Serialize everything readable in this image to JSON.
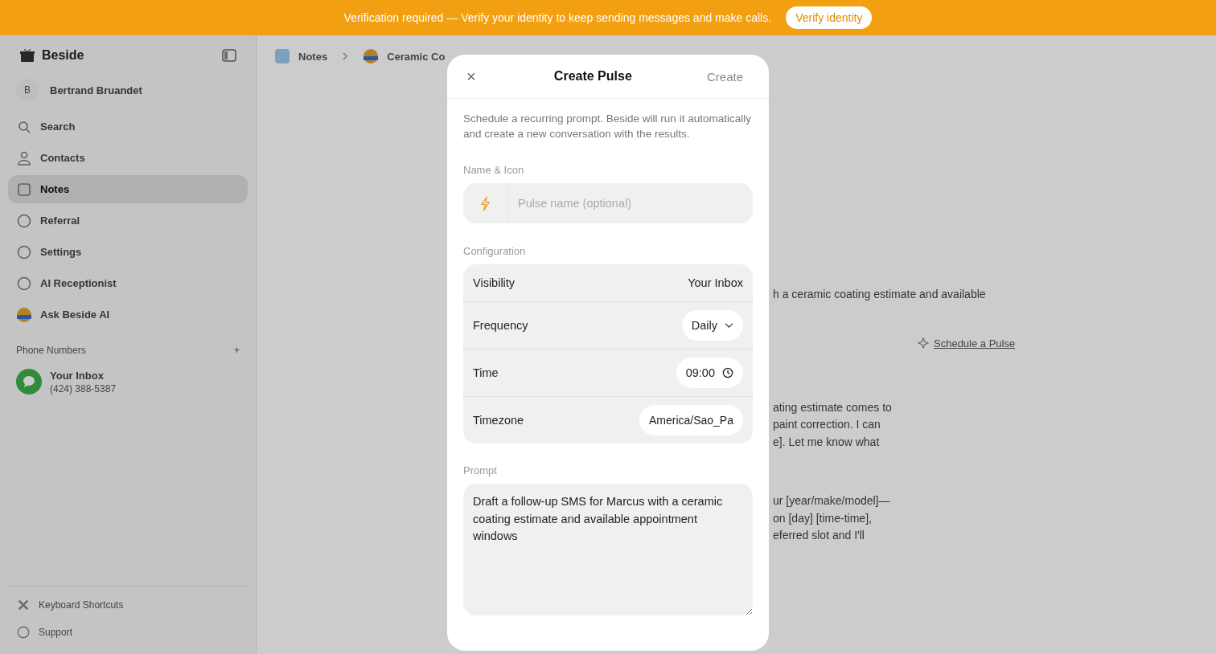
{
  "banner": {
    "message": "Verification required — Verify your identity to keep sending messages and make calls.",
    "button": "Verify identity"
  },
  "sidebar": {
    "brand": "Beside",
    "user": {
      "initial": "B",
      "name": "Bertrand Bruandet"
    },
    "items": [
      {
        "label": "Search",
        "selected": false
      },
      {
        "label": "Contacts",
        "selected": false
      },
      {
        "label": "Notes",
        "selected": true
      },
      {
        "label": "Referral",
        "selected": false
      },
      {
        "label": "Settings",
        "selected": false
      },
      {
        "label": "AI Receptionist",
        "selected": false
      },
      {
        "label": "Ask Beside AI",
        "selected": false
      }
    ],
    "section_title": "Phone Numbers",
    "section_action": "+",
    "inboxes": [
      {
        "name": "Your Inbox",
        "phone": "(424) 388-5387"
      }
    ],
    "footer_items": [
      "Keyboard Shortcuts",
      "Support"
    ]
  },
  "breadcrumb": [
    "Notes",
    "Ceramic Co"
  ],
  "conversation": {
    "first_line": "h a ceramic coating estimate and available",
    "link": "Schedule a Pulse",
    "paragraphs": [
      [
        "ating estimate comes to",
        "paint correction. I can",
        "e]. Let me know what"
      ],
      [
        "ur [year/make/model]—",
        "on [day] [time-time],",
        "eferred slot and I'll"
      ]
    ]
  },
  "modal": {
    "close": "×",
    "title": "Create Pulse",
    "action": "Create",
    "description": "Schedule a recurring prompt. Beside will run it automatically and create a new conversation with the results.",
    "name_label": "Name & Icon",
    "name_placeholder": "Pulse name (optional)",
    "config_label": "Configuration",
    "config": [
      {
        "kind": "text",
        "label": "Visibility",
        "value": "Your Inbox"
      },
      {
        "kind": "select",
        "label": "Frequency",
        "value": "Daily"
      },
      {
        "kind": "time",
        "label": "Time",
        "value": "09:00"
      },
      {
        "kind": "field",
        "label": "Timezone",
        "value": "America/Sao_Pa"
      }
    ],
    "prompt_label": "Prompt",
    "prompt": "Draft a follow-up SMS for Marcus with a ceramic coating estimate and available appointment windows"
  }
}
